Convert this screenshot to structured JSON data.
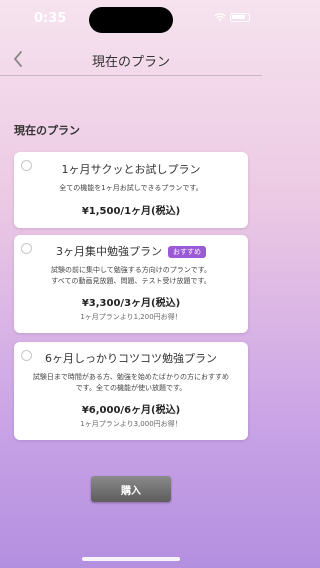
{
  "status_bar": {
    "time": "0:35"
  },
  "nav": {
    "title": "現在のプラン"
  },
  "section": {
    "title": "現在のプラン"
  },
  "plans": [
    {
      "name": "1ヶ月サクッとお試しプラン",
      "description_lines": [
        "全ての機能を1ヶ月お試しできるプランです。"
      ],
      "price": "¥1,500/1ヶ月(税込)",
      "savings": "",
      "badge": ""
    },
    {
      "name": "3ヶ月集中勉強プラン",
      "description_lines": [
        "試験の前に集中して勉強する方向けのプランです。",
        "すべての動画見放題、問題、テスト受け放題です。"
      ],
      "price": "¥3,300/3ヶ月(税込)",
      "savings": "1ヶ月プランより1,200円お得！",
      "badge": "おすすめ"
    },
    {
      "name": "6ヶ月しっかりコツコツ勉強プラン",
      "description_lines": [
        "試験日まで時間がある方、勉強を始めたばかりの方におすすめ",
        "です。全ての機能が使い放題です。"
      ],
      "price": "¥6,000/6ヶ月(税込)",
      "savings": "1ヶ月プランより3,000円お得！",
      "badge": ""
    }
  ],
  "purchase_button": {
    "label": "購入"
  },
  "colors": {
    "accent": "#9a5ad6",
    "button": "#6e6e6e"
  },
  "icons": {
    "back": "chevron-left-icon",
    "wifi": "wifi-icon",
    "battery": "battery-icon"
  }
}
